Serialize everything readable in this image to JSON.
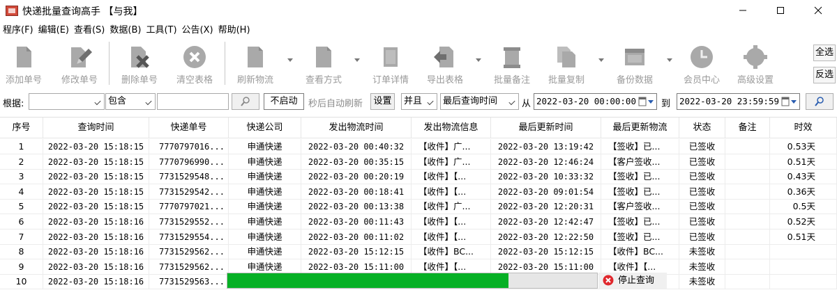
{
  "window": {
    "title": "快递批量查询高手 【与我】"
  },
  "menu": [
    "程序(F)",
    "编辑(E)",
    "查看(S)",
    "数据(B)",
    "工具(T)",
    "公告(X)",
    "帮助(H)"
  ],
  "toolbar": {
    "add": "添加单号",
    "modify": "修改单号",
    "delete": "删除单号",
    "clear": "清空表格",
    "refresh": "刷新物流",
    "view_mode": "查看方式",
    "order_detail": "订单详情",
    "export": "导出表格",
    "batch_note": "批量备注",
    "batch_copy": "批量复制",
    "backup": "备份数据",
    "member": "会员中心",
    "advanced": "高级设置",
    "select_all": "全选",
    "invert": "反选"
  },
  "filter": {
    "label": "根据:",
    "field_value": "",
    "op_value": "包含",
    "keyword_value": "",
    "auto_refresh_btn": "不启动",
    "auto_refresh_text": "秒后自动刷新",
    "settings_btn": "设置",
    "logic_value": "并且",
    "time_field_value": "最后查询时间",
    "from_label": "从",
    "from_value": "2022-03-20 00:00:00",
    "to_label": "到",
    "to_value": "2022-03-20 23:59:59"
  },
  "table": {
    "headers": [
      "序号",
      "查询时间",
      "快递单号",
      "快递公司",
      "发出物流时间",
      "发出物流信息",
      "最后更新时间",
      "最后更新物流",
      "状态",
      "备注",
      "时效"
    ],
    "rows": [
      [
        "1",
        "2022-03-20 15:18:15",
        "7770797016...",
        "申通快递",
        "2022-03-20 00:40:32",
        "【收件】广...",
        "2022-03-20 13:19:42",
        "【签收】已...",
        "已签收",
        "",
        "0.53天"
      ],
      [
        "2",
        "2022-03-20 15:18:15",
        "7770796990...",
        "申通快递",
        "2022-03-20 00:35:15",
        "【收件】广...",
        "2022-03-20 12:46:24",
        "【客户签收...",
        "已签收",
        "",
        "0.51天"
      ],
      [
        "3",
        "2022-03-20 15:18:15",
        "7731529548...",
        "申通快递",
        "2022-03-20 00:20:19",
        "【收件】【...",
        "2022-03-20 10:33:32",
        "【签收】已...",
        "已签收",
        "",
        "0.43天"
      ],
      [
        "4",
        "2022-03-20 15:18:15",
        "7731529542...",
        "申通快递",
        "2022-03-20 00:18:41",
        "【收件】【...",
        "2022-03-20 09:01:54",
        "【签收】已...",
        "已签收",
        "",
        "0.36天"
      ],
      [
        "5",
        "2022-03-20 15:18:15",
        "7770797021...",
        "申通快递",
        "2022-03-20 00:13:38",
        "【收件】广...",
        "2022-03-20 12:20:31",
        "【客户签收...",
        "已签收",
        "",
        "0.5天"
      ],
      [
        "6",
        "2022-03-20 15:18:16",
        "7731529552...",
        "申通快递",
        "2022-03-20 00:11:43",
        "【收件】【...",
        "2022-03-20 12:42:47",
        "【签收】已...",
        "已签收",
        "",
        "0.52天"
      ],
      [
        "7",
        "2022-03-20 15:18:16",
        "7731529554...",
        "申通快递",
        "2022-03-20 00:11:02",
        "【收件】【...",
        "2022-03-20 12:22:50",
        "【签收】已...",
        "已签收",
        "",
        "0.51天"
      ],
      [
        "8",
        "2022-03-20 15:18:16",
        "7731529562...",
        "申通快递",
        "2022-03-20 15:12:15",
        "【收件】BC...",
        "2022-03-20 15:12:15",
        "【收件】BC...",
        "未签收",
        "",
        ""
      ],
      [
        "9",
        "2022-03-20 15:18:16",
        "7731529562...",
        "申通快递",
        "2022-03-20 15:11:00",
        "【收件】【...",
        "2022-03-20 15:11:00",
        "【收件】【...",
        "未签收",
        "",
        ""
      ],
      [
        "10",
        "2022-03-20 15:18:16",
        "7731529563...",
        "",
        "",
        "",
        "",
        "",
        "未签收",
        "",
        ""
      ]
    ]
  },
  "progress": {
    "fraction": 0.76,
    "color": "#06b025"
  },
  "stop_button": {
    "label": "停止查询"
  }
}
